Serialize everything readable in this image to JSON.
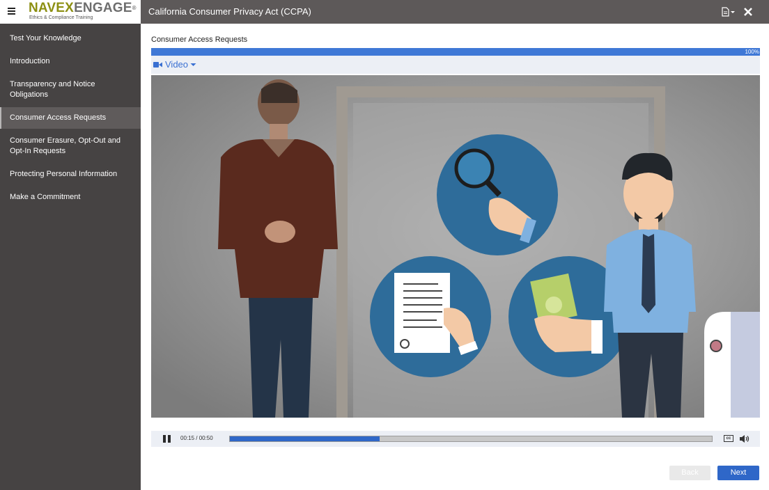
{
  "logo": {
    "brand_a": "NAVEX",
    "brand_b": "ENGAGE",
    "reg": "®",
    "tagline": "Ethics & Compliance Training"
  },
  "header": {
    "title": "California Consumer Privacy Act (CCPA)"
  },
  "sidebar": {
    "items": [
      {
        "label": "Test Your Knowledge",
        "active": false
      },
      {
        "label": "Introduction",
        "active": false
      },
      {
        "label": "Transparency and Notice Obligations",
        "active": false
      },
      {
        "label": "Consumer Access Requests",
        "active": true
      },
      {
        "label": "Consumer Erasure, Opt-Out and Opt-In Requests",
        "active": false
      },
      {
        "label": "Protecting Personal Information",
        "active": false
      },
      {
        "label": "Make a Commitment",
        "active": false
      }
    ]
  },
  "main": {
    "lesson_title": "Consumer Access Requests",
    "progress_label": "100%",
    "progress_value": 1.0,
    "media_tab_label": "Video",
    "player": {
      "time": "00:15 / 00:50",
      "played_fraction": 0.31,
      "cc_label": "cc"
    },
    "back_label": "Back",
    "next_label": "Next"
  },
  "colors": {
    "topbar": "#5d5959",
    "sidebar": "#464343",
    "accent": "#2f67c8",
    "logo_green": "#8c8f12"
  }
}
